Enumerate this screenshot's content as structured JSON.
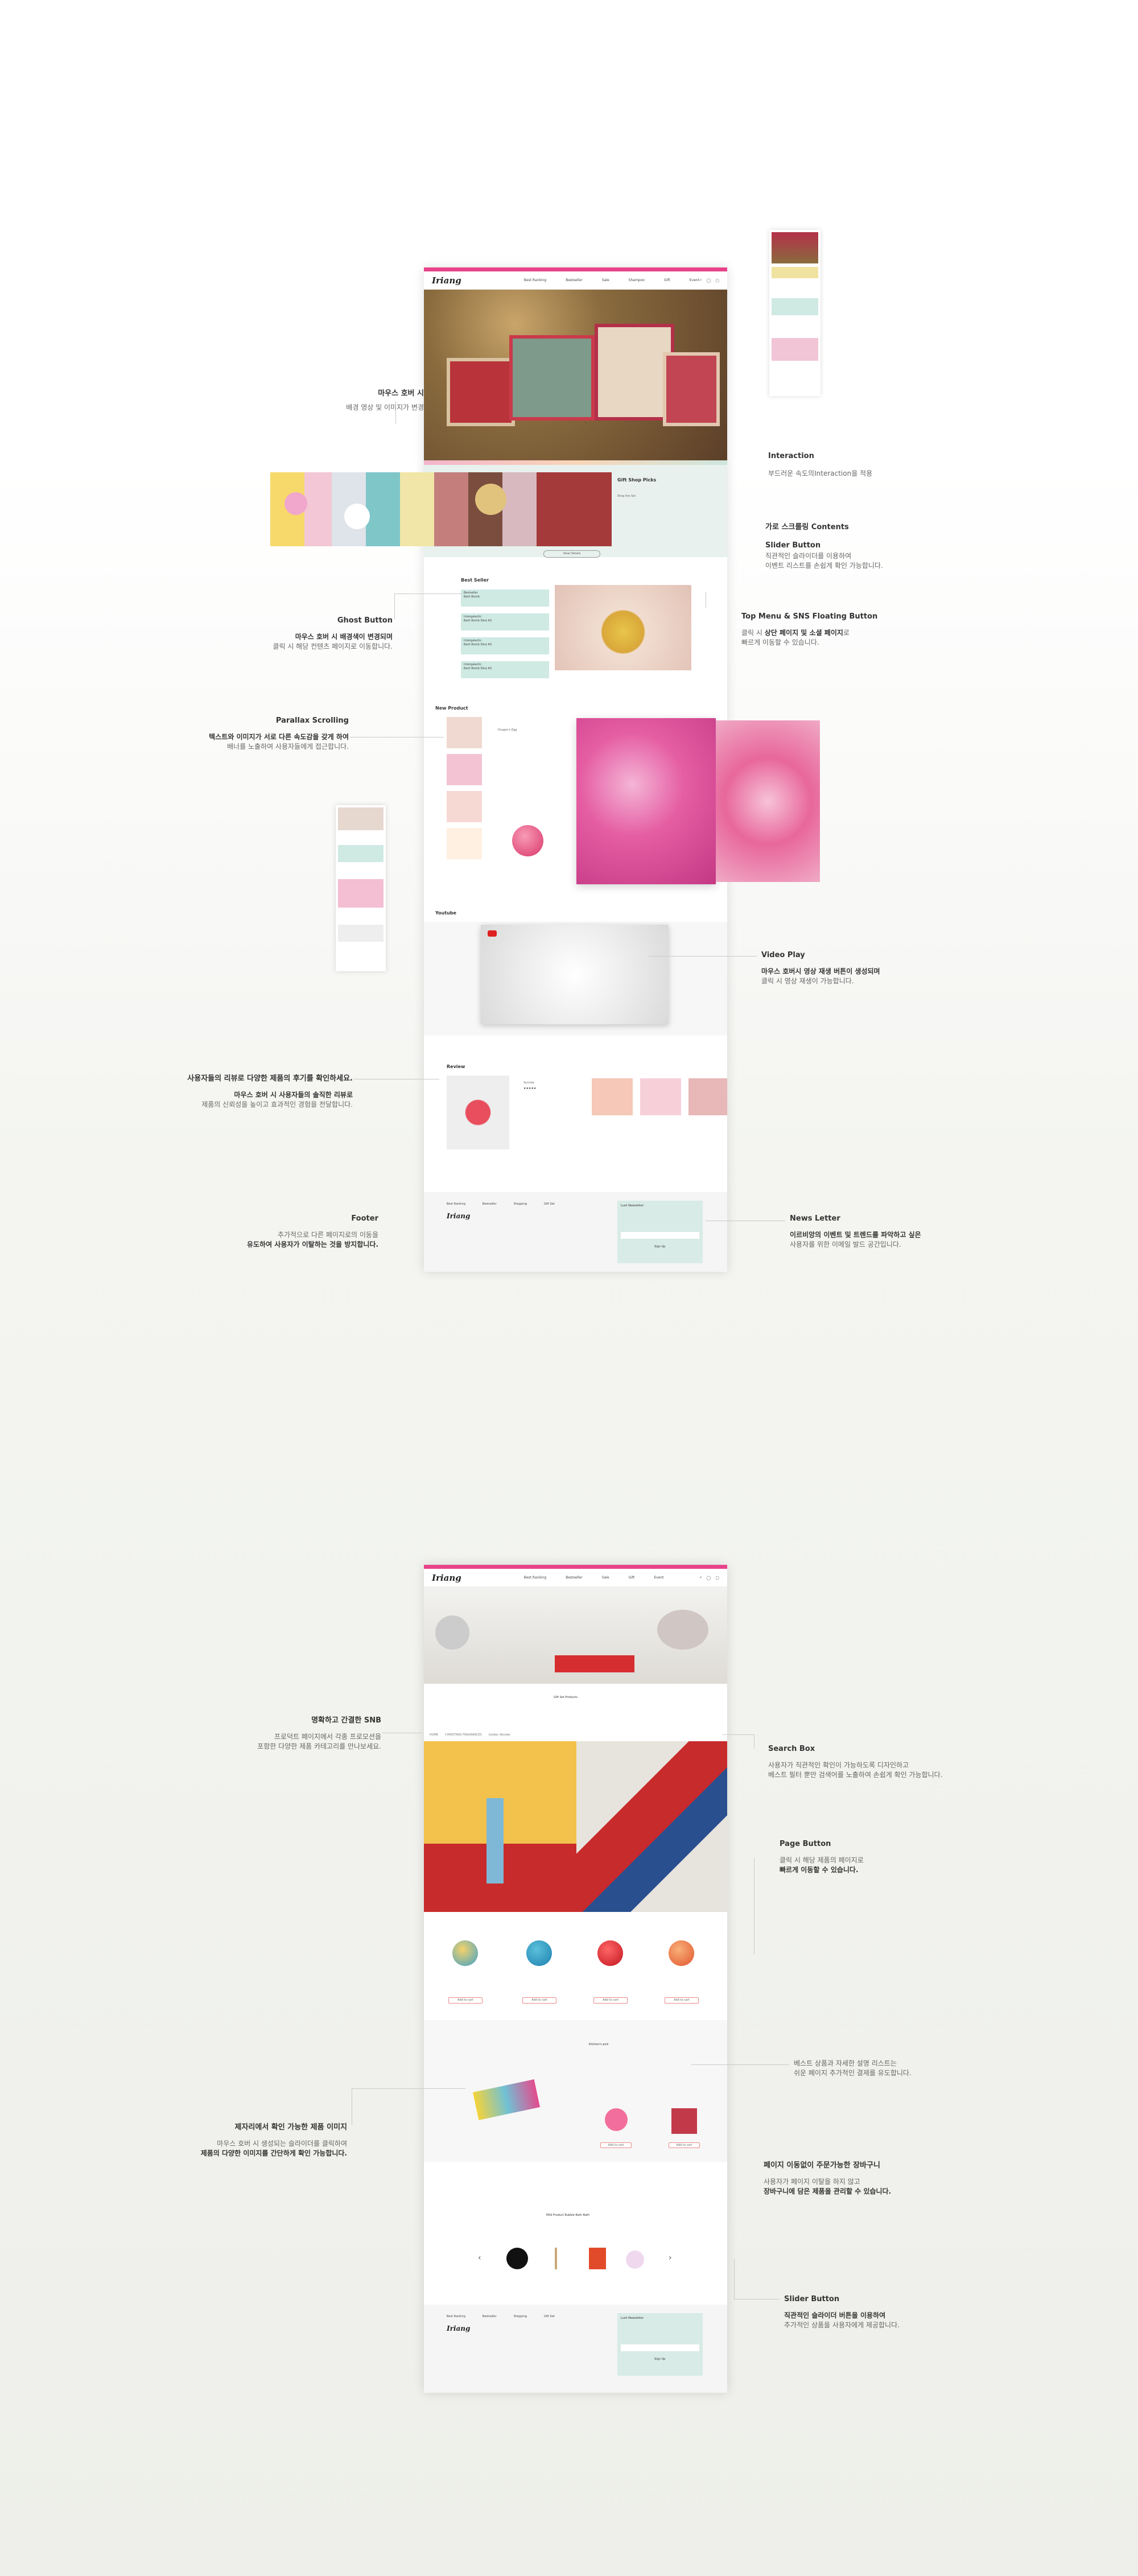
{
  "site": {
    "logo": "Iriang",
    "nav_main": [
      "Best Ranking",
      "Bestseller",
      "Sale",
      "Shampoo",
      "Gift",
      "Event"
    ],
    "nav_sub": [
      "Best Ranking",
      "Bestseller",
      "Sale",
      "Gift",
      "Event"
    ],
    "header_icons": [
      "search-icon",
      "user-icon",
      "cart-icon"
    ],
    "section_titles": {
      "gift_shop": "Gift Shop Picks",
      "best_seller": "Best Seller",
      "new_product": "New Product",
      "youtube": "Youtube",
      "review": "Review",
      "newsletter": "Lush Newsletter",
      "reco": "Kitchen's pick",
      "slider": "Mild Product Bubble Bath Bath"
    },
    "gift_text": "Shop the Set",
    "more_button": "View Details",
    "best_items": [
      "Bestseller\nBath Bomb",
      "Intergalactic\nBath Bomb Slice Kit",
      "Intergalactic\nBath Bomb Slice Kit",
      "Intergalactic\nBath Bomb Slice Kit"
    ],
    "product_name": "Dragon's Egg",
    "review_name": "Sunrise",
    "review_stars": "★★★★★",
    "footer_links": [
      "Best Ranking",
      "Bestseller",
      "Shopping",
      "Gift Set"
    ],
    "subscribe_button": "Sign Up",
    "product_detail_title": "Gift Set Products",
    "page_crumbs": [
      "HOME",
      "CHRISTMAS FRAGRANCES",
      "Golden Wonder"
    ],
    "buy_button": "Add to cart"
  },
  "annotations": {
    "hover_bg": {
      "title": "마우스 호버 시",
      "desc": "배경 영상 및 이미지가 변경"
    },
    "interaction": {
      "title": "Interaction",
      "desc": "부드러운 속도의Interaction을 적용"
    },
    "horizontal_scroll": {
      "title": "가로 스크롤링 Contents"
    },
    "slider_button_1": {
      "title": "Slider Button",
      "desc1": "직관적인 슬라이더를 이용하여",
      "desc2": "이벤트 리스트를 손쉽게 확인 가능합니다."
    },
    "ghost_button": {
      "title": "Ghost Button",
      "desc1": "마우스 호버 시 배경색이 변경되며",
      "desc2": "클릭 시 해당 컨텐츠 페이지로 이동합니다."
    },
    "top_menu": {
      "title": "Top Menu & SNS Floating Button",
      "desc1a": "클릭 시 ",
      "desc1b": "상단 페이지 및 소셜 페이지",
      "desc1c": "로",
      "desc2": "빠르게 이동할 수 있습니다."
    },
    "parallax": {
      "title": "Parallax Scrolling",
      "desc1": "텍스트와 이미지가 서로 다른 속도감을 갖게 하여",
      "desc2": "배너를 노출하여 사용자들에게 접근합니다."
    },
    "video": {
      "title": "Video Play",
      "desc1": "마우스 호버시 영상 재생 버튼이 생성되며",
      "desc2": "클릭 시 영상 재생이 가능합니다."
    },
    "review": {
      "title": "사용자들의 리뷰로 다양한 제품의 후기를 확인하세요.",
      "desc1": "마우스 호버 시 사용자들의 솔직한 리뷰로",
      "desc2": "제품의 신뢰성을 높이고 효과적인 경험을 전달합니다."
    },
    "footer": {
      "title": "Footer",
      "desc1": "추가적으로 다른 페이지로의 이동을",
      "desc2": "유도하여 사용자가 이탈하는 것을 방지합니다."
    },
    "newsletter": {
      "title": "News Letter",
      "desc1": "이르비앙의 이벤트 및 트렌드를 파악하고 싶은",
      "desc2": "사용자를 위한 이메일 발드 공간입니다."
    },
    "snb": {
      "title": "명확하고 간결한 SNB",
      "desc1": "프로덕트 페이지에서 각종 프로모션을",
      "desc2": "포함한 다양한 제품 카테고리를 만나보세요."
    },
    "search": {
      "title": "Search Box",
      "desc1": "사용자가 직관적인 확인이 가능하도록 디자인하고",
      "desc2": "베스트 필터 뿐만 검색어를 노출하여 손쉽게 확인 가능합니다."
    },
    "page_button": {
      "title": "Page Button",
      "desc1": "클릭 시 해당 제품의 페이지로",
      "desc2": "빠르게 이동할 수 있습니다."
    },
    "best_reco": {
      "desc1": "베스트 상품과 자세한 설명 리스트는",
      "desc2": "쉬운 페이지 추가적인 결제를 유도합니다."
    },
    "detail_image": {
      "title": "제자리에서 확인 가능한 제품 이미지",
      "desc1": "마우스 호버 시 생성되는 슬라이더를 클릭하여",
      "desc2": "제품의 다양한 이미지를 간단하게 확인 가능합니다."
    },
    "cart": {
      "title": "페이지 이동없이 주문가능한 장바구니",
      "desc1": "사용자가 페이지 이탈을 하지 않고",
      "desc2": "장바구니에 담은 제품을 관리할 수 있습니다."
    },
    "slider_button_2": {
      "title": "Slider Button",
      "desc1": "직관적인 슬라이더 버튼을 이용하여",
      "desc2": "추가적인 상품을 사용자에게 제공합니다."
    }
  },
  "colors": {
    "accent": "#e8438a",
    "mint": "#cfe9e3",
    "text": "#333333",
    "muted": "#666666"
  }
}
